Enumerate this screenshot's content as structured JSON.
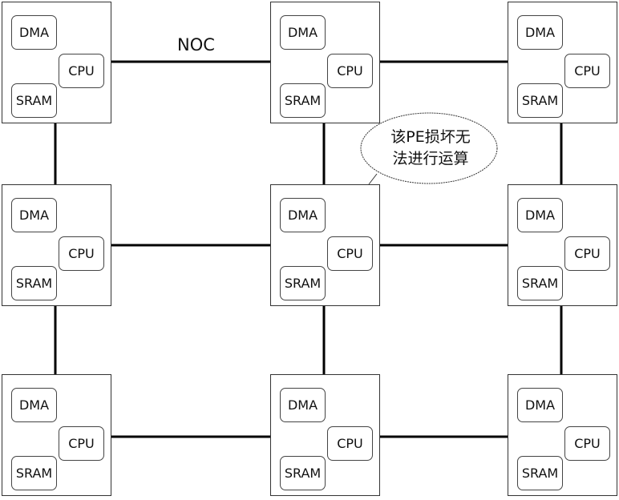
{
  "diagram": {
    "network_label": "NOC",
    "pe_units": [
      "DMA",
      "CPU",
      "SRAM"
    ],
    "grid": {
      "rows": 3,
      "cols": 3
    },
    "pes": [
      {
        "row": 0,
        "col": 0,
        "units": {
          "dma": "DMA",
          "cpu": "CPU",
          "sram": "SRAM"
        }
      },
      {
        "row": 0,
        "col": 1,
        "units": {
          "dma": "DMA",
          "cpu": "CPU",
          "sram": "SRAM"
        }
      },
      {
        "row": 0,
        "col": 2,
        "units": {
          "dma": "DMA",
          "cpu": "CPU",
          "sram": "SRAM"
        }
      },
      {
        "row": 1,
        "col": 0,
        "units": {
          "dma": "DMA",
          "cpu": "CPU",
          "sram": "SRAM"
        }
      },
      {
        "row": 1,
        "col": 1,
        "units": {
          "dma": "DMA",
          "cpu": "CPU",
          "sram": "SRAM"
        },
        "damaged": true
      },
      {
        "row": 1,
        "col": 2,
        "units": {
          "dma": "DMA",
          "cpu": "CPU",
          "sram": "SRAM"
        }
      },
      {
        "row": 2,
        "col": 0,
        "units": {
          "dma": "DMA",
          "cpu": "CPU",
          "sram": "SRAM"
        }
      },
      {
        "row": 2,
        "col": 1,
        "units": {
          "dma": "DMA",
          "cpu": "CPU",
          "sram": "SRAM"
        }
      },
      {
        "row": 2,
        "col": 2,
        "units": {
          "dma": "DMA",
          "cpu": "CPU",
          "sram": "SRAM"
        }
      }
    ],
    "callout": {
      "line1": "该PE损坏无",
      "line2": "法进行运算",
      "target": {
        "row": 1,
        "col": 1
      }
    }
  }
}
